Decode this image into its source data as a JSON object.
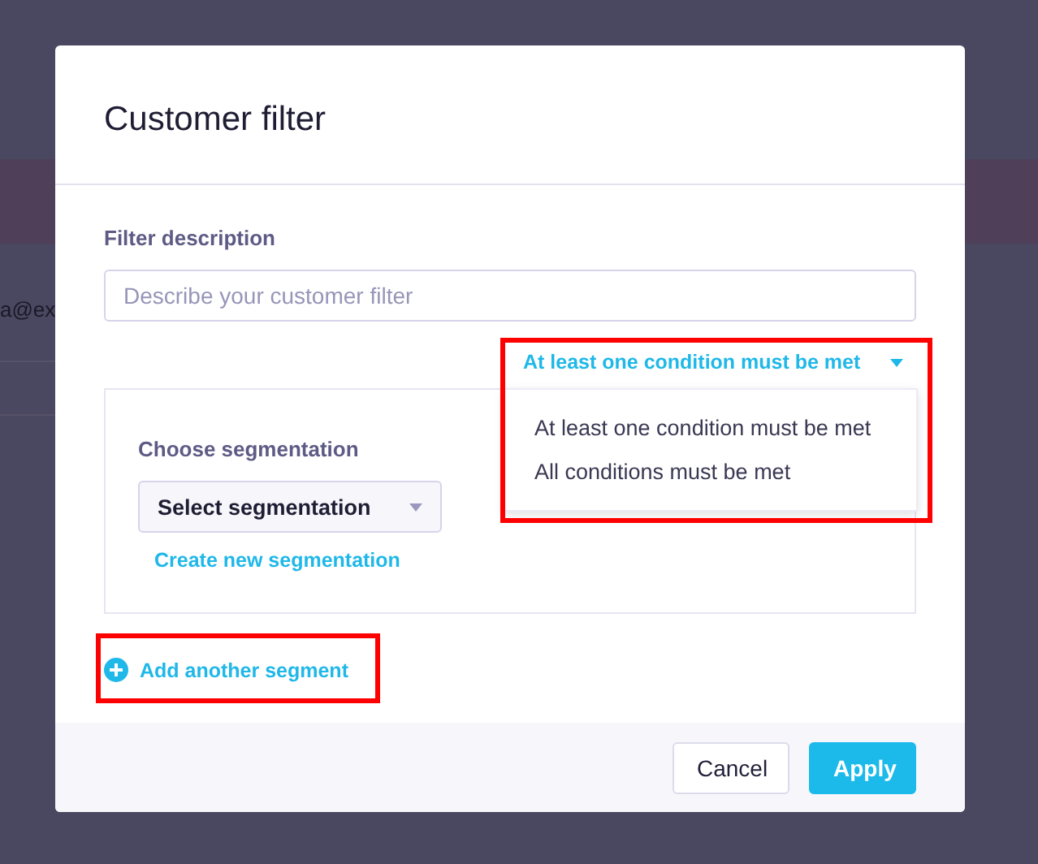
{
  "background": {
    "text": "a@ex"
  },
  "dialog": {
    "title": "Customer filter",
    "filter_description": {
      "label": "Filter description",
      "placeholder": "Describe your customer filter"
    },
    "condition_dropdown": {
      "value": "At least one condition must be met",
      "expanded": true,
      "highlighted": true,
      "options": [
        "At least one condition must be met",
        "All conditions must be met"
      ]
    },
    "segment": {
      "label": "Choose segmentation",
      "select": "Select segmentation",
      "create_link": "Create new segmentation"
    },
    "add_segment": {
      "label": "Add another segment",
      "highlighted": true
    },
    "buttons": [
      {
        "label": "Cancel",
        "kind": "secondary"
      },
      {
        "label": "Apply",
        "kind": "primary"
      }
    ]
  }
}
